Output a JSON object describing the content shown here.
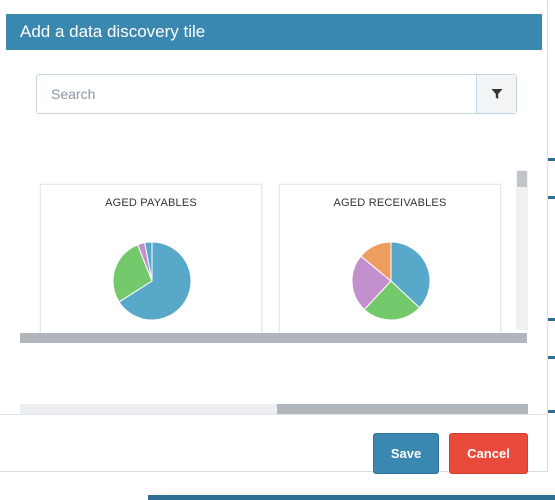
{
  "modal": {
    "title": "Add a data discovery tile"
  },
  "search": {
    "placeholder": "Search",
    "value": "",
    "filter_icon": "filter-icon"
  },
  "tiles": [
    {
      "title": "AGED PAYABLES",
      "chart_data": {
        "type": "pie",
        "slices": [
          {
            "value": 0.66,
            "color": "#57a8c9"
          },
          {
            "value": 0.28,
            "color": "#73c96b"
          },
          {
            "value": 0.03,
            "color": "#c38fcc"
          },
          {
            "value": 0.03,
            "color": "#57a8c9"
          }
        ]
      }
    },
    {
      "title": "AGED RECEIVABLES",
      "chart_data": {
        "type": "pie",
        "slices": [
          {
            "value": 0.37,
            "color": "#57a8c9"
          },
          {
            "value": 0.25,
            "color": "#73c96b"
          },
          {
            "value": 0.24,
            "color": "#c38fcc"
          },
          {
            "value": 0.14,
            "color": "#ed9d5f"
          }
        ]
      }
    }
  ],
  "footer": {
    "save_label": "Save",
    "cancel_label": "Cancel"
  },
  "colors": {
    "accent": "#3a87b0",
    "danger": "#e84a3c"
  }
}
